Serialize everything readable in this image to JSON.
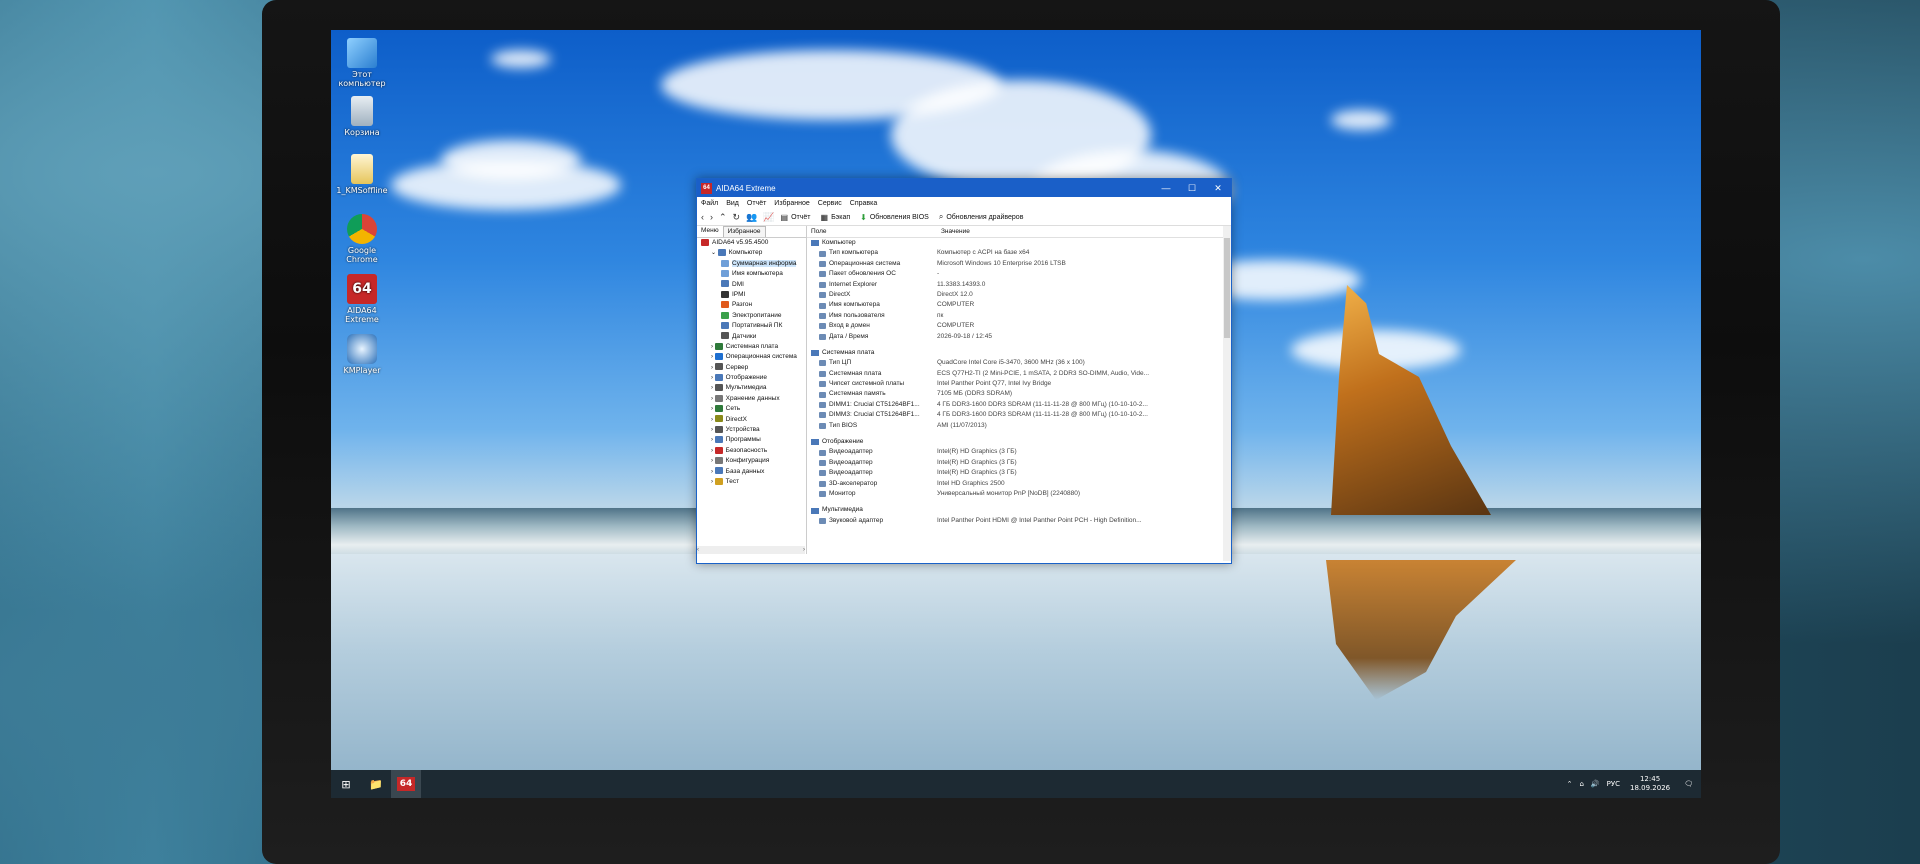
{
  "desktop_icons": [
    {
      "label": "Этот компьютер",
      "icon": "this-pc-icon"
    },
    {
      "label": "Корзина",
      "icon": "recycle-bin-icon"
    },
    {
      "label": "1_KMSoffline",
      "icon": "folder-icon"
    },
    {
      "label": "Google Chrome",
      "icon": "chrome-icon"
    },
    {
      "label": "AIDA64 Extreme",
      "icon": "aida64-icon"
    },
    {
      "label": "KMPlayer",
      "icon": "kmplayer-icon"
    }
  ],
  "window": {
    "app_icon": "64",
    "title": "AIDA64 Extreme",
    "controls": {
      "minimize": "—",
      "maximize": "☐",
      "close": "✕"
    }
  },
  "menu": [
    "Файл",
    "Вид",
    "Отчёт",
    "Избранное",
    "Сервис",
    "Справка"
  ],
  "toolbar": {
    "nav_glyphs": [
      "‹",
      "›",
      "⌃",
      "↻",
      "👥",
      "📈"
    ],
    "report": "Отчёт",
    "backup": "Бэкап",
    "bios_updates": "Обновления BIOS",
    "driver_updates": "Обновления драйверов"
  },
  "left_tabs": [
    "Меню",
    "Избранное"
  ],
  "tree": [
    {
      "label": "AIDA64 v5.95.4500",
      "level": 0,
      "color": "#c62828"
    },
    {
      "label": "Компьютер",
      "level": 1,
      "color": "#4a78b8"
    },
    {
      "label": "Суммарная информа",
      "level": 2,
      "color": "#6f9fd8",
      "selected": true
    },
    {
      "label": "Имя компьютера",
      "level": 2,
      "color": "#6f9fd8"
    },
    {
      "label": "DMI",
      "level": 2,
      "color": "#4a78b8"
    },
    {
      "label": "IPMI",
      "level": 2,
      "color": "#333333"
    },
    {
      "label": "Разгон",
      "level": 2,
      "color": "#e05a1c"
    },
    {
      "label": "Электропитание",
      "level": 2,
      "color": "#3aa04a"
    },
    {
      "label": "Портативный ПК",
      "level": 2,
      "color": "#4a78b8"
    },
    {
      "label": "Датчики",
      "level": 2,
      "color": "#555555"
    },
    {
      "label": "Системная плата",
      "level": 1,
      "color": "#2f7a3a"
    },
    {
      "label": "Операционная система",
      "level": 1,
      "color": "#1e6fd0"
    },
    {
      "label": "Сервер",
      "level": 1,
      "color": "#555555"
    },
    {
      "label": "Отображение",
      "level": 1,
      "color": "#4a78b8"
    },
    {
      "label": "Мультимедиа",
      "level": 1,
      "color": "#555555"
    },
    {
      "label": "Хранение данных",
      "level": 1,
      "color": "#777777"
    },
    {
      "label": "Сеть",
      "level": 1,
      "color": "#2f7a3a"
    },
    {
      "label": "DirectX",
      "level": 1,
      "color": "#8a8a1a"
    },
    {
      "label": "Устройства",
      "level": 1,
      "color": "#555555"
    },
    {
      "label": "Программы",
      "level": 1,
      "color": "#4a78b8"
    },
    {
      "label": "Безопасность",
      "level": 1,
      "color": "#c62828"
    },
    {
      "label": "Конфигурация",
      "level": 1,
      "color": "#777777"
    },
    {
      "label": "База данных",
      "level": 1,
      "color": "#4a78b8"
    },
    {
      "label": "Тест",
      "level": 1,
      "color": "#d0a020"
    }
  ],
  "columns": {
    "field": "Поле",
    "value": "Значение"
  },
  "sections": [
    {
      "title": "Компьютер",
      "rows": [
        {
          "field": "Тип компьютера",
          "value": "Компьютер с ACPI на базе x64"
        },
        {
          "field": "Операционная система",
          "value": "Microsoft Windows 10 Enterprise 2016 LTSB"
        },
        {
          "field": "Пакет обновления ОС",
          "value": "-"
        },
        {
          "field": "Internet Explorer",
          "value": "11.3383.14393.0"
        },
        {
          "field": "DirectX",
          "value": "DirectX 12.0"
        },
        {
          "field": "Имя компьютера",
          "value": "COMPUTER"
        },
        {
          "field": "Имя пользователя",
          "value": "пк"
        },
        {
          "field": "Вход в домен",
          "value": "COMPUTER"
        },
        {
          "field": "Дата / Время",
          "value": "2026-09-18 / 12:45"
        }
      ]
    },
    {
      "title": "Системная плата",
      "rows": [
        {
          "field": "Тип ЦП",
          "value": "QuadCore Intel Core i5-3470, 3600 MHz (36 x 100)"
        },
        {
          "field": "Системная плата",
          "value": "ECS Q77H2-TI  (2 Mini-PCIE, 1 mSATA, 2 DDR3 SO-DIMM, Audio, Vide..."
        },
        {
          "field": "Чипсет системной платы",
          "value": "Intel Panther Point Q77, Intel Ivy Bridge"
        },
        {
          "field": "Системная память",
          "value": "7105 МБ  (DDR3 SDRAM)"
        },
        {
          "field": "DIMM1: Crucial CT51264BF1...",
          "value": "4 ГБ DDR3-1600 DDR3 SDRAM  (11-11-11-28 @ 800 МГц)  (10-10-10-2..."
        },
        {
          "field": "DIMM3: Crucial CT51264BF1...",
          "value": "4 ГБ DDR3-1600 DDR3 SDRAM  (11-11-11-28 @ 800 МГц)  (10-10-10-2..."
        },
        {
          "field": "Тип BIOS",
          "value": "AMI (11/07/2013)"
        }
      ]
    },
    {
      "title": "Отображение",
      "rows": [
        {
          "field": "Видеоадаптер",
          "value": "Intel(R) HD Graphics  (3 ГБ)"
        },
        {
          "field": "Видеоадаптер",
          "value": "Intel(R) HD Graphics  (3 ГБ)"
        },
        {
          "field": "Видеоадаптер",
          "value": "Intel(R) HD Graphics  (3 ГБ)"
        },
        {
          "field": "3D-акселератор",
          "value": "Intel HD Graphics 2500"
        },
        {
          "field": "Монитор",
          "value": "Универсальный монитор PnP [NoDB]  (2240880)"
        }
      ]
    },
    {
      "title": "Мультимедиа",
      "rows": [
        {
          "field": "Звуковой адаптер",
          "value": "Intel Panther Point HDMI @ Intel Panther Point PCH - High Definition..."
        }
      ]
    }
  ],
  "taskbar": {
    "start": "⊞",
    "explorer": "📁",
    "aida": "64",
    "tray": {
      "chevron": "⌃",
      "network": "⌂",
      "volume": "🔊",
      "lang": "РУС",
      "time": "12:45",
      "date": "18.09.2026",
      "notify": "🗨"
    }
  }
}
